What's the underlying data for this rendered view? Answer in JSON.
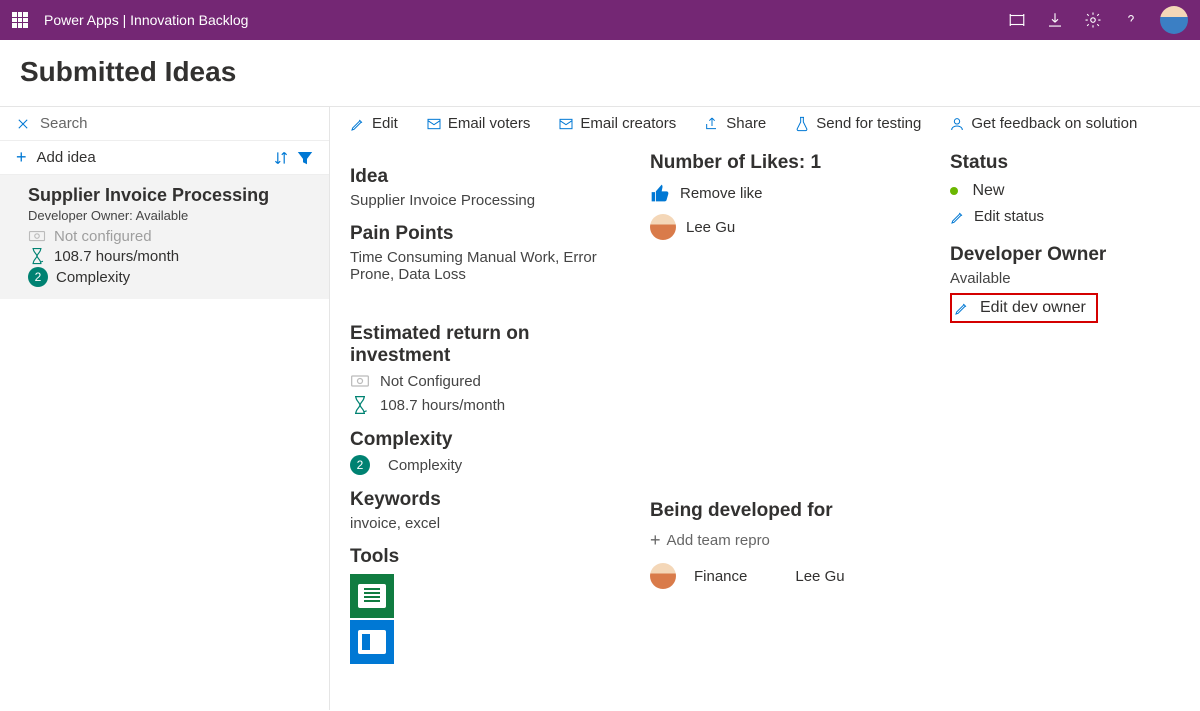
{
  "header": {
    "app": "Power Apps",
    "sep": " | ",
    "title": "Innovation Backlog"
  },
  "pageTitle": "Submitted Ideas",
  "sidebar": {
    "search": "Search",
    "addIdea": "Add idea",
    "idea": {
      "title": "Supplier Invoice Processing",
      "owner": "Developer Owner: Available",
      "configured": "Not configured",
      "hours": "108.7 hours/month",
      "complexityBadge": "2",
      "complexity": "Complexity"
    }
  },
  "toolbar": {
    "edit": "Edit",
    "emailVoters": "Email voters",
    "emailCreators": "Email creators",
    "share": "Share",
    "sendTesting": "Send for testing",
    "getFeedback": "Get feedback on solution"
  },
  "detail": {
    "ideaLabel": "Idea",
    "ideaVal": "Supplier Invoice Processing",
    "painLabel": "Pain Points",
    "painVal": "Time Consuming Manual Work, Error Prone, Data Loss",
    "roiLabel": "Estimated return on investment",
    "roiConfigured": "Not Configured",
    "roiHours": "108.7 hours/month",
    "complexityLabel": "Complexity",
    "complexityBadge": "2",
    "complexityVal": "Complexity",
    "keywordsLabel": "Keywords",
    "keywordsVal": "invoice, excel",
    "toolsLabel": "Tools"
  },
  "likes": {
    "heading": "Number of Likes: 1",
    "remove": "Remove like",
    "person": "Lee Gu",
    "devForLabel": "Being developed for",
    "addTeam": "Add team repro",
    "team": "Finance",
    "teamPerson": "Lee Gu"
  },
  "status": {
    "label": "Status",
    "value": "New",
    "editStatus": "Edit status",
    "devOwnerLabel": "Developer Owner",
    "devOwnerVal": "Available",
    "editDevOwner": "Edit dev owner"
  }
}
